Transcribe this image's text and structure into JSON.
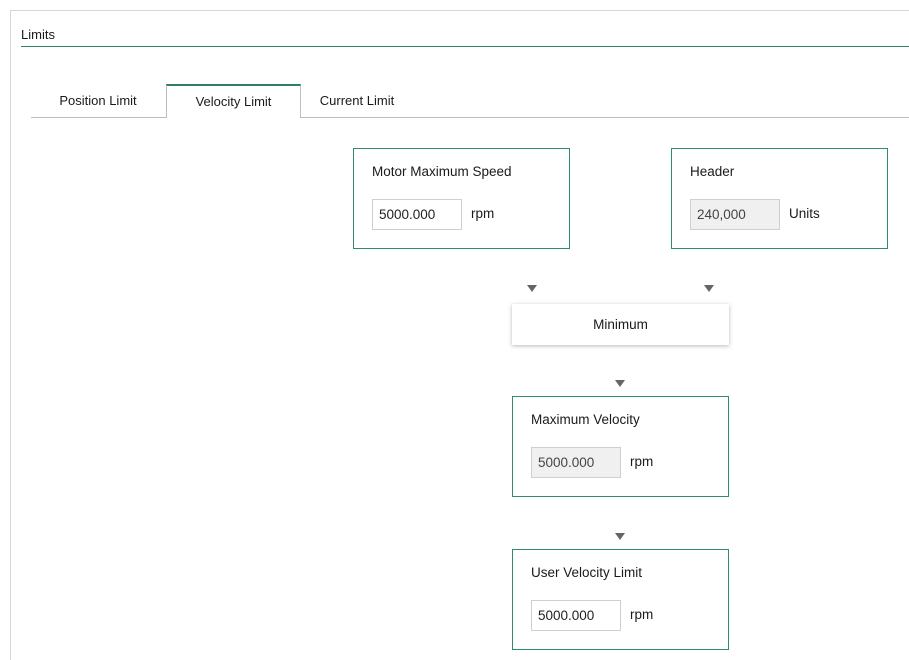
{
  "group": {
    "title": "Limits"
  },
  "tabs": [
    {
      "label": "Position Limit",
      "active": false
    },
    {
      "label": "Velocity Limit",
      "active": true
    },
    {
      "label": "Current Limit",
      "active": false
    }
  ],
  "motor_max_speed": {
    "title": "Motor Maximum Speed",
    "value": "5000.000",
    "unit": "rpm"
  },
  "header": {
    "title": "Header",
    "value": "240,000",
    "unit": "Units"
  },
  "minimum": {
    "label": "Minimum"
  },
  "max_velocity": {
    "title": "Maximum Velocity",
    "value": "5000.000",
    "unit": "rpm"
  },
  "user_velocity_limit": {
    "title": "User Velocity Limit",
    "value": "5000.000",
    "unit": "rpm"
  },
  "colors": {
    "accent": "#2f8a73",
    "arrow": "#666666"
  },
  "icons": {
    "flow_arrow": "triangle-down-icon"
  }
}
